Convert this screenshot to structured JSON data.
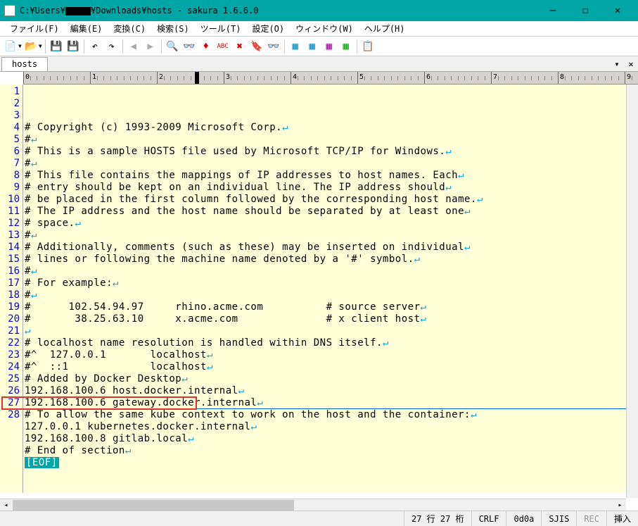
{
  "window": {
    "title_prefix": "C:¥Users¥",
    "title_suffix": "¥Downloads¥hosts - sakura 1.6.6.0"
  },
  "menu": {
    "file": "ファイル(F)",
    "edit": "編集(E)",
    "convert": "変換(C)",
    "search": "検索(S)",
    "tool": "ツール(T)",
    "setting": "設定(O)",
    "window": "ウィンドウ(W)",
    "help": "ヘルプ(H)"
  },
  "tab": {
    "name": "hosts"
  },
  "ruler": {
    "max": 9
  },
  "lines": [
    "# Copyright (c) 1993-2009 Microsoft Corp.",
    "#",
    "# This is a sample HOSTS file used by Microsoft TCP/IP for Windows.",
    "#",
    "# This file contains the mappings of IP addresses to host names. Each",
    "# entry should be kept on an individual line. The IP address should",
    "# be placed in the first column followed by the corresponding host name.",
    "# The IP address and the host name should be separated by at least one",
    "# space.",
    "#",
    "# Additionally, comments (such as these) may be inserted on individual",
    "# lines or following the machine name denoted by a '#' symbol.",
    "#",
    "# For example:",
    "#",
    "#      102.54.94.97     rhino.acme.com          # source server",
    "#       38.25.63.10     x.acme.com              # x client host",
    "",
    "# localhost name resolution is handled within DNS itself.",
    "#^  127.0.0.1       localhost",
    "#^  ::1             localhost",
    "# Added by Docker Desktop",
    "192.168.100.6 host.docker.internal",
    "192.168.100.6 gateway.docker.internal",
    "# To allow the same kube context to work on the host and the container:",
    "127.0.0.1 kubernetes.docker.internal",
    "192.168.100.8 gitlab.local",
    "# End of section"
  ],
  "eol_mark": "↵",
  "eof_label": "[EOF]",
  "highlight_line": 27,
  "status": {
    "pos": "27 行 27 桁",
    "crlf": "CRLF",
    "code": "0d0a",
    "enc": "SJIS",
    "rec": "REC",
    "ins": "挿入"
  }
}
